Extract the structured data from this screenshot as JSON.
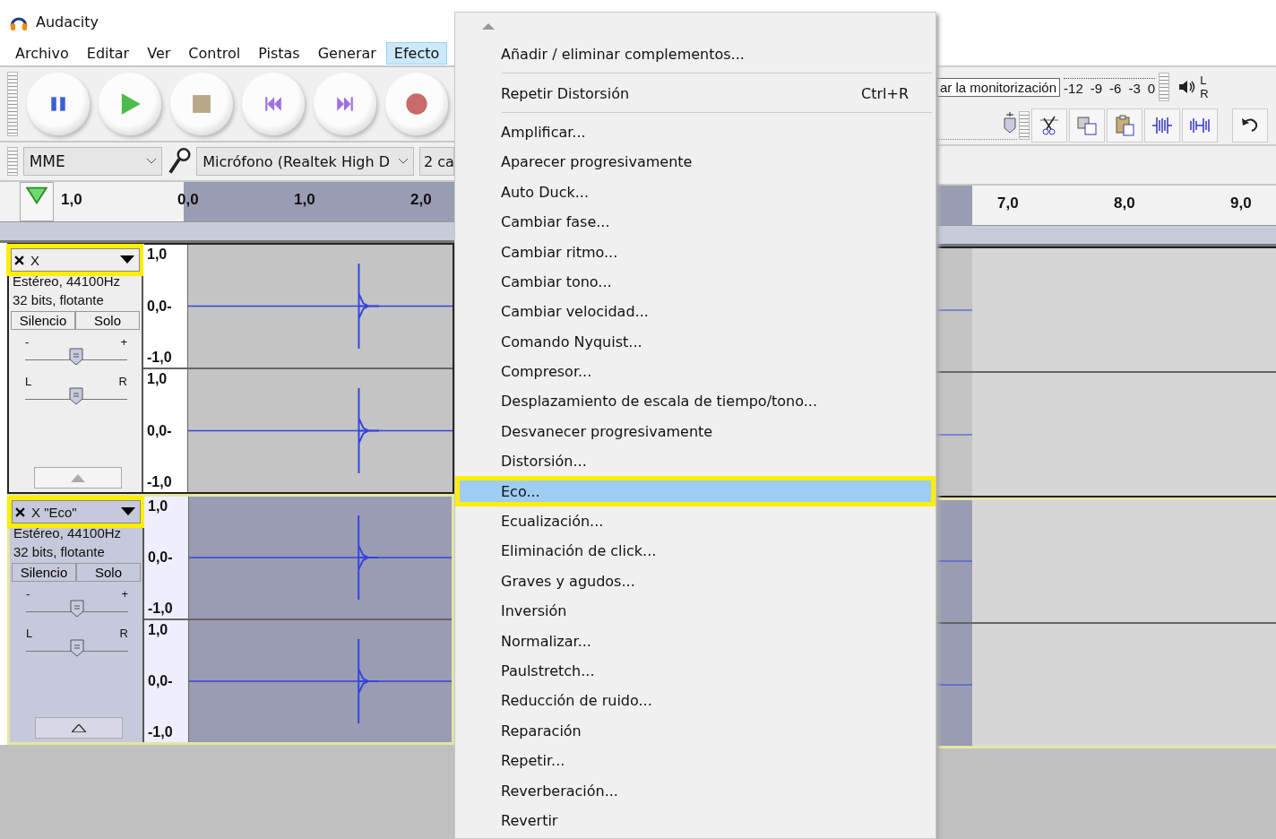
{
  "window": {
    "title": "Audacity"
  },
  "menubar": [
    {
      "label": "Archivo",
      "selected": false
    },
    {
      "label": "Editar",
      "selected": false
    },
    {
      "label": "Ver",
      "selected": false
    },
    {
      "label": "Control",
      "selected": false
    },
    {
      "label": "Pistas",
      "selected": false
    },
    {
      "label": "Generar",
      "selected": false
    },
    {
      "label": "Efecto",
      "selected": true
    }
  ],
  "device_toolbar": {
    "host": "MME",
    "input_device": "Micrófono (Realtek High D",
    "channels": "2 ca"
  },
  "ruler": {
    "left_ticks": [
      "1,0",
      "0,0",
      "1,0",
      "2,0"
    ],
    "right_ticks": [
      "7,0",
      "8,0",
      "9,0"
    ]
  },
  "meter_toolbar": {
    "tooltip": "ar la monitorización",
    "ticks": [
      "-12",
      "-9",
      "-6",
      "-3",
      "0"
    ],
    "channel_labels": [
      "L",
      "R"
    ]
  },
  "tracks": [
    {
      "name": "X",
      "highlighted": true,
      "selected": false,
      "format": "Estéreo, 44100Hz",
      "sample_format": "32 bits, flotante",
      "mute_button": "Silencio",
      "solo_button": "Solo",
      "gain": {
        "min_label": "-",
        "max_label": "+",
        "level": 0.5
      },
      "pan": {
        "min_label": "L",
        "max_label": "R",
        "level": 0.5
      },
      "channels": [
        {
          "scale": [
            "1,0",
            "0,0-",
            "-1,0"
          ]
        },
        {
          "scale": [
            "1,0",
            "0,0-",
            "-1,0"
          ]
        }
      ]
    },
    {
      "name": "X \"Eco\"",
      "highlighted": true,
      "selected": true,
      "format": "Estéreo, 44100Hz",
      "sample_format": "32 bits, flotante",
      "mute_button": "Silencio",
      "solo_button": "Solo",
      "gain": {
        "min_label": "-",
        "max_label": "+",
        "level": 0.5
      },
      "pan": {
        "min_label": "L",
        "max_label": "R",
        "level": 0.5
      },
      "channels": [
        {
          "scale": [
            "1,0",
            "0,0-",
            "-1,0"
          ]
        },
        {
          "scale": [
            "1,0",
            "0,0-",
            "-1,0"
          ]
        }
      ]
    }
  ],
  "menu": {
    "items": [
      {
        "kind": "item",
        "label": "Añadir / eliminar complementos...",
        "selected": false,
        "highlighted": false
      },
      {
        "kind": "separator"
      },
      {
        "kind": "item",
        "label": "Repetir Distorsión",
        "shortcut": "Ctrl+R",
        "selected": false,
        "highlighted": false
      },
      {
        "kind": "separator"
      },
      {
        "kind": "item",
        "label": "Amplificar...",
        "selected": false,
        "highlighted": false
      },
      {
        "kind": "item",
        "label": "Aparecer progresivamente",
        "selected": false,
        "highlighted": false
      },
      {
        "kind": "item",
        "label": "Auto Duck...",
        "selected": false,
        "highlighted": false
      },
      {
        "kind": "item",
        "label": "Cambiar fase...",
        "selected": false,
        "highlighted": false
      },
      {
        "kind": "item",
        "label": "Cambiar ritmo...",
        "selected": false,
        "highlighted": false
      },
      {
        "kind": "item",
        "label": "Cambiar tono...",
        "selected": false,
        "highlighted": false
      },
      {
        "kind": "item",
        "label": "Cambiar velocidad...",
        "selected": false,
        "highlighted": false
      },
      {
        "kind": "item",
        "label": "Comando Nyquist...",
        "selected": false,
        "highlighted": false
      },
      {
        "kind": "item",
        "label": "Compresor...",
        "selected": false,
        "highlighted": false
      },
      {
        "kind": "item",
        "label": "Desplazamiento de escala de tiempo/tono...",
        "selected": false,
        "highlighted": false
      },
      {
        "kind": "item",
        "label": "Desvanecer progresivamente",
        "selected": false,
        "highlighted": false
      },
      {
        "kind": "item",
        "label": "Distorsión...",
        "selected": false,
        "highlighted": false
      },
      {
        "kind": "item",
        "label": "Eco...",
        "selected": true,
        "highlighted": true
      },
      {
        "kind": "item",
        "label": "Ecualización...",
        "selected": false,
        "highlighted": false
      },
      {
        "kind": "item",
        "label": "Eliminación de click...",
        "selected": false,
        "highlighted": false
      },
      {
        "kind": "item",
        "label": "Graves y agudos...",
        "selected": false,
        "highlighted": false
      },
      {
        "kind": "item",
        "label": "Inversión",
        "selected": false,
        "highlighted": false
      },
      {
        "kind": "item",
        "label": "Normalizar...",
        "selected": false,
        "highlighted": false
      },
      {
        "kind": "item",
        "label": "Paulstretch...",
        "selected": false,
        "highlighted": false
      },
      {
        "kind": "item",
        "label": "Reducción de ruido...",
        "selected": false,
        "highlighted": false
      },
      {
        "kind": "item",
        "label": "Reparación",
        "selected": false,
        "highlighted": false
      },
      {
        "kind": "item",
        "label": "Repetir...",
        "selected": false,
        "highlighted": false
      },
      {
        "kind": "item",
        "label": "Reverberación...",
        "selected": false,
        "highlighted": false
      },
      {
        "kind": "item",
        "label": "Revertir",
        "selected": false,
        "highlighted": false
      }
    ]
  }
}
